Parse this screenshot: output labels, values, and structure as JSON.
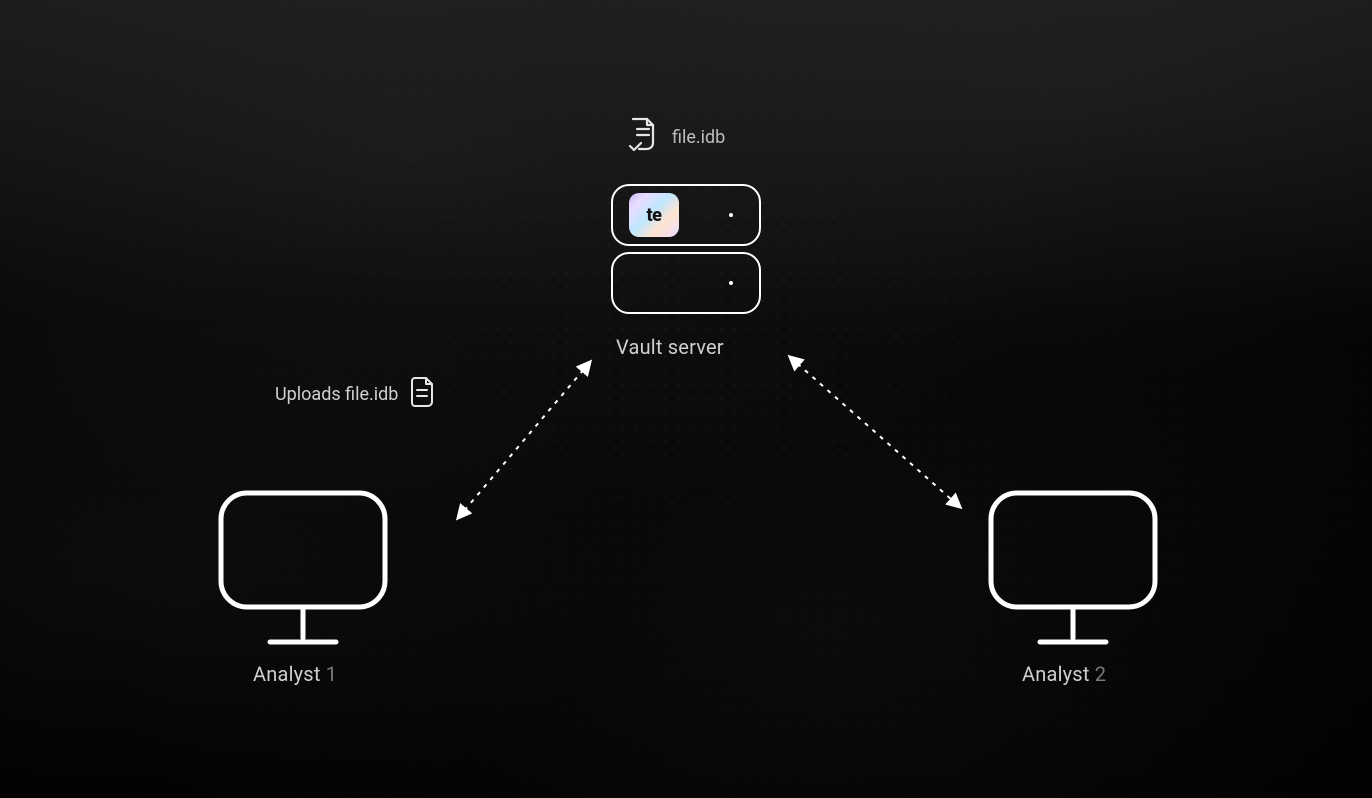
{
  "file": {
    "name": "file.idb"
  },
  "server": {
    "label": "Vault server",
    "chip_text": "te"
  },
  "upload": {
    "label": "Uploads file.idb"
  },
  "analysts": {
    "left": {
      "prefix": "Analyst ",
      "num": "1"
    },
    "right": {
      "prefix": "Analyst ",
      "num": "2"
    }
  }
}
